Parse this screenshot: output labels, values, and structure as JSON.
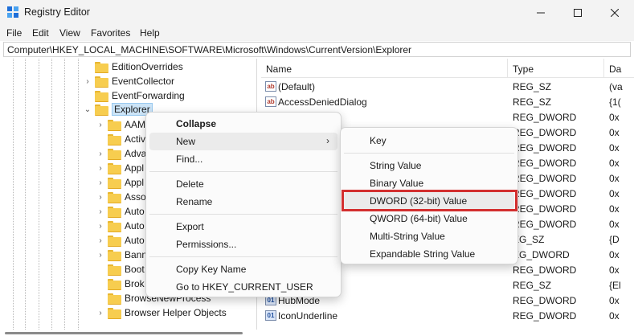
{
  "window": {
    "title": "Registry Editor"
  },
  "menubar": [
    "File",
    "Edit",
    "View",
    "Favorites",
    "Help"
  ],
  "address": "Computer\\HKEY_LOCAL_MACHINE\\SOFTWARE\\Microsoft\\Windows\\CurrentVersion\\Explorer",
  "tree": [
    {
      "label": "EditionOverrides",
      "expander": "",
      "selected": false
    },
    {
      "label": "EventCollector",
      "expander": "›",
      "selected": false
    },
    {
      "label": "EventForwarding",
      "expander": "",
      "selected": false
    },
    {
      "label": "Explorer",
      "expander": "⌄",
      "selected": true
    },
    {
      "label": "AAM",
      "expander": "›",
      "selected": false
    },
    {
      "label": "Activ",
      "expander": "",
      "selected": false
    },
    {
      "label": "Adva",
      "expander": "›",
      "selected": false
    },
    {
      "label": "Appl",
      "expander": "›",
      "selected": false
    },
    {
      "label": "Appl",
      "expander": "›",
      "selected": false
    },
    {
      "label": "Asso",
      "expander": "›",
      "selected": false
    },
    {
      "label": "Auto",
      "expander": "›",
      "selected": false
    },
    {
      "label": "Auto",
      "expander": "›",
      "selected": false
    },
    {
      "label": "Auto",
      "expander": "›",
      "selected": false
    },
    {
      "label": "Bann",
      "expander": "›",
      "selected": false
    },
    {
      "label": "Boot",
      "expander": "",
      "selected": false
    },
    {
      "label": "Brok",
      "expander": "",
      "selected": false
    },
    {
      "label": "BrowseNewProcess",
      "expander": "",
      "selected": false
    },
    {
      "label": "Browser Helper Objects",
      "expander": "›",
      "selected": false
    }
  ],
  "columns": {
    "name": "Name",
    "type": "Type",
    "data": "Da"
  },
  "values": [
    {
      "icon": "ab",
      "kind": "sz",
      "name": "(Default)",
      "type": "REG_SZ",
      "data": "(va"
    },
    {
      "icon": "ab",
      "kind": "sz",
      "name": "AccessDeniedDialog",
      "type": "REG_SZ",
      "data": "{1("
    },
    {
      "icon": "01",
      "kind": "dw",
      "name": "abled",
      "type": "REG_DWORD",
      "data": "0x"
    },
    {
      "icon": "01",
      "kind": "dw",
      "name": "",
      "type": "REG_DWORD",
      "data": "0x"
    },
    {
      "icon": "01",
      "kind": "dw",
      "name": "",
      "type": "REG_DWORD",
      "data": "0x"
    },
    {
      "icon": "01",
      "kind": "dw",
      "name": "",
      "type": "REG_DWORD",
      "data": "0x"
    },
    {
      "icon": "01",
      "kind": "dw",
      "name": "",
      "type": "REG_DWORD",
      "data": "0x"
    },
    {
      "icon": "01",
      "kind": "dw",
      "name": "",
      "type": "REG_DWORD",
      "data": "0x"
    },
    {
      "icon": "01",
      "kind": "dw",
      "name": "",
      "type": "REG_DWORD",
      "data": "0x"
    },
    {
      "icon": "01",
      "kind": "dw",
      "name": "",
      "type": "REG_DWORD",
      "data": "0x"
    },
    {
      "icon": "ab",
      "kind": "sz",
      "name": "",
      "type": "EG_SZ",
      "data": "{D"
    },
    {
      "icon": "01",
      "kind": "dw",
      "name": "",
      "type": "EG_DWORD",
      "data": "0x"
    },
    {
      "icon": "01",
      "kind": "dw",
      "name": "angedCounter",
      "type": "REG_DWORD",
      "data": "0x"
    },
    {
      "icon": "ab",
      "kind": "sz",
      "name": "ttings",
      "type": "REG_SZ",
      "data": "{El"
    },
    {
      "icon": "01",
      "kind": "dw",
      "name": "HubMode",
      "type": "REG_DWORD",
      "data": "0x"
    },
    {
      "icon": "01",
      "kind": "dw",
      "name": "IconUnderline",
      "type": "REG_DWORD",
      "data": "0x"
    }
  ],
  "context_menu": {
    "collapse": "Collapse",
    "new": "New",
    "find": "Find...",
    "delete": "Delete",
    "rename": "Rename",
    "export": "Export",
    "permissions": "Permissions...",
    "copy_key_name": "Copy Key Name",
    "goto_hkcu": "Go to HKEY_CURRENT_USER"
  },
  "new_submenu": {
    "key": "Key",
    "string": "String Value",
    "binary": "Binary Value",
    "dword": "DWORD (32-bit) Value",
    "qword": "QWORD (64-bit) Value",
    "multi_string": "Multi-String Value",
    "expandable_string": "Expandable String Value"
  },
  "colors": {
    "highlight_border": "#d32f2f",
    "selection": "#cce4f7"
  }
}
